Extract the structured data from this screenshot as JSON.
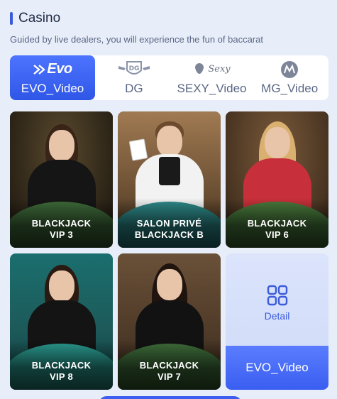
{
  "header": {
    "title": "Casino",
    "subtitle": "Guided by live dealers, you will experience the fun of baccarat"
  },
  "tabs": [
    {
      "label": "EVO_Video",
      "logo_text": "Evo",
      "icon": "evo-logo-icon",
      "active": true
    },
    {
      "label": "DG",
      "icon": "dg-logo-icon",
      "active": false
    },
    {
      "label": "SEXY_Video",
      "logo_text": "Sexy",
      "icon": "sexy-logo-icon",
      "active": false
    },
    {
      "label": "MG_Video",
      "icon": "mg-logo-icon",
      "active": false
    }
  ],
  "games": [
    {
      "title": "BLACKJACK\nVIP 3"
    },
    {
      "title": "SALON PRIVÉ\nBLACKJACK B"
    },
    {
      "title": "BLACKJACK\nVIP 6"
    },
    {
      "title": "BLACKJACK\nVIP 8"
    },
    {
      "title": "BLACKJACK\nVIP 7"
    }
  ],
  "detail_card": {
    "detail_label": "Detail",
    "provider_label": "EVO_Video",
    "icon": "grid-icon"
  },
  "colors": {
    "accent": "#3b5bdb",
    "page_bg": "#e8eef9",
    "tab_active": "#2f56e6"
  }
}
